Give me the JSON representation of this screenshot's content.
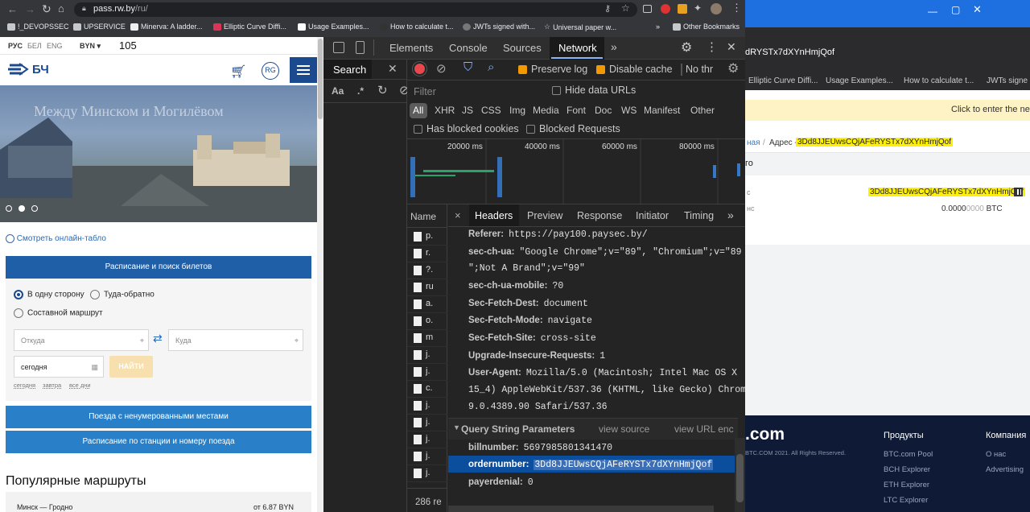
{
  "browser": {
    "url": "pass.rw.by/ru/",
    "url_host": "pass.rw.by",
    "url_path": "/ru/",
    "bookmarks": [
      "!_DEVOPSSEC",
      "UPSERVICE",
      "Minerva: A ladder...",
      "Elliptic Curve Diffi...",
      "Usage Examples...",
      "How to calculate t...",
      "JWTs signed with...",
      "Universal paper w..."
    ],
    "other_bookmarks": "Other Bookmarks",
    "chevron": "»"
  },
  "site": {
    "langs": [
      "РУС",
      "БЕЛ",
      "ENG"
    ],
    "currency": "BYN",
    "zoom_counter": "105",
    "logo_text": "БЧ",
    "account_badge": "RG",
    "hero_title": "Между Минском и Могилёвом",
    "online_board_link": "Смотреть онлайн-табло",
    "schedule_button": "Расписание и поиск билетов",
    "trip_types": [
      "В одну сторону",
      "Туда-обратно",
      "Составной маршрут"
    ],
    "from_placeholder": "Откуда",
    "to_placeholder": "Куда",
    "date_value": "сегодня",
    "find_button": "НАЙТИ",
    "date_shortcuts": [
      "сегодня",
      "завтра",
      "все дни"
    ],
    "unnumbered_button": "Поезда с ненумерованными местами",
    "station_button": "Расписание по станции и номеру поезда",
    "popular_title": "Популярные маршруты",
    "popular_row_route": "Минск — Гродно",
    "popular_row_price": "от 6.87 BYN"
  },
  "devtools": {
    "tabs": [
      "Elements",
      "Console",
      "Sources",
      "Network"
    ],
    "active_tab": "Network",
    "search_label": "Search",
    "search_opts": [
      "Aa",
      ".*"
    ],
    "preserve_log": "Preserve log",
    "disable_cache": "Disable cache",
    "throttle": "No thr",
    "filter_placeholder": "Filter",
    "hide_data_urls": "Hide data URLs",
    "filter_types": [
      "All",
      "XHR",
      "JS",
      "CSS",
      "Img",
      "Media",
      "Font",
      "Doc",
      "WS",
      "Manifest",
      "Other"
    ],
    "has_blocked_cookies": "Has blocked cookies",
    "blocked_requests": "Blocked Requests",
    "timeline_ticks": [
      "20000 ms",
      "40000 ms",
      "60000 ms",
      "80000 ms"
    ],
    "name_header": "Name",
    "name_rows": [
      "p.",
      "r.",
      "?.",
      "ru",
      "a.",
      "o.",
      "m",
      "j.",
      "j.",
      "c.",
      "j.",
      "j.",
      "j.",
      "j.",
      "j."
    ],
    "requests_count": "286 re",
    "detail_tabs": [
      "Headers",
      "Preview",
      "Response",
      "Initiator",
      "Timing"
    ],
    "headers": [
      {
        "k": "Referer:",
        "v": "https://pay100.paysec.by/"
      },
      {
        "k": "sec-ch-ua:",
        "v": "\"Google Chrome\";v=\"89\", \"Chromium\";v=\"89"
      },
      {
        "k": "",
        "v": "\";Not A Brand\";v=\"99\""
      },
      {
        "k": "sec-ch-ua-mobile:",
        "v": "?0"
      },
      {
        "k": "Sec-Fetch-Dest:",
        "v": "document"
      },
      {
        "k": "Sec-Fetch-Mode:",
        "v": "navigate"
      },
      {
        "k": "Sec-Fetch-Site:",
        "v": "cross-site"
      },
      {
        "k": "Upgrade-Insecure-Requests:",
        "v": "1"
      },
      {
        "k": "User-Agent:",
        "v": "Mozilla/5.0 (Macintosh; Intel Mac OS X"
      },
      {
        "k": "",
        "v": "15_4) AppleWebKit/537.36 (KHTML, like Gecko) Chrom"
      },
      {
        "k": "",
        "v": "9.0.4389.90 Safari/537.36"
      }
    ],
    "qsp_title": "Query String Parameters",
    "view_source": "view source",
    "view_url_enc": "view URL enc",
    "params": [
      {
        "k": "billnumber:",
        "v": "5697985801341470"
      },
      {
        "k": "ordernumber:",
        "v": "3Dd8JJEUwsCQjAFeRYSTx7dXYnHmjQof"
      },
      {
        "k": "payerdenial:",
        "v": "0"
      }
    ]
  },
  "background_window": {
    "title_tail": "dRYSTx7dXYnHmjQof",
    "bookmarks": [
      "Elliptic Curve Diffi...",
      "Usage Examples...",
      "How to calculate t...",
      "JWTs signe"
    ],
    "banner": "Click to enter the ne",
    "crumb_prefix": "ная",
    "crumb_label": "Адрес -",
    "crumb_address": "3Dd8JJEUwsCQjAFeRYSTx7dXYnHmjQof",
    "section_tail": "го",
    "row_label_1": "с",
    "address_value": "3Dd8JJEUwsCQjAFeRYSTx7dXYnHmjQof",
    "row_label_2": "нс",
    "balance_main": "0.0000",
    "balance_dim": "0000",
    "balance_unit": "BTC",
    "footer_logo": ".com",
    "copyright": "BTC.COM 2021. All Rights Reserved.",
    "col1_title": "Продукты",
    "col1_items": [
      "BTC.com Pool",
      "BCH Explorer",
      "ETH Explorer",
      "LTC Explorer"
    ],
    "col2_title": "Компания",
    "col2_items": [
      "О нас",
      "Advertising"
    ]
  },
  "colors": {
    "brand_blue": "#1c4a8e",
    "button_blue": "#2a80c8",
    "devtools_bg": "#242424",
    "selected_row": "#0b4e9e",
    "highlight": "#fff000"
  }
}
